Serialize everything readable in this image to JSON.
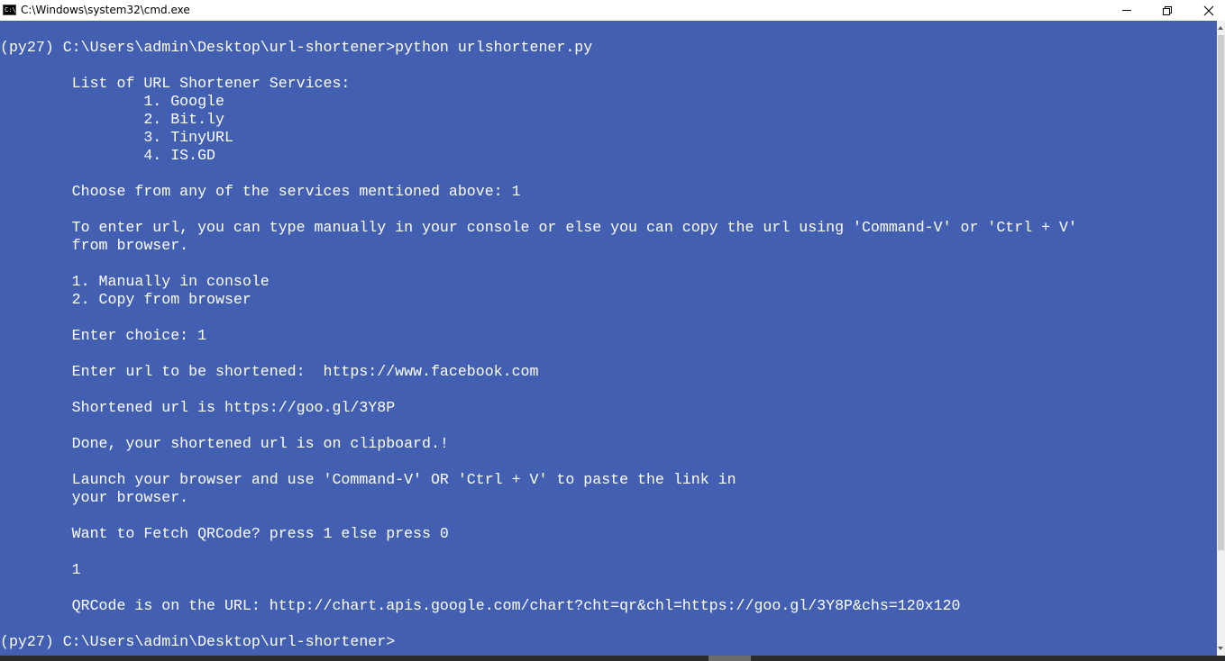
{
  "window": {
    "title": "C:\\Windows\\system32\\cmd.exe",
    "icon": "cmd-console-icon",
    "icon_glyph": "C:\\"
  },
  "controls": {
    "minimize_icon": "minimize-icon",
    "restore_icon": "restore-icon",
    "close_icon": "close-icon"
  },
  "colors": {
    "console_background": "#425fb1",
    "console_text": "#ffffff",
    "titlebar_background": "#ffffff"
  },
  "console": {
    "lines": [
      "(py27) C:\\Users\\admin\\Desktop\\url-shortener>python urlshortener.py",
      "",
      "        List of URL Shortener Services:",
      "                1. Google",
      "                2. Bit.ly",
      "                3. TinyURL",
      "                4. IS.GD",
      "",
      "        Choose from any of the services mentioned above: 1",
      "",
      "        To enter url, you can type manually in your console or else you can copy the url using 'Command-V' or 'Ctrl + V'",
      "        from browser.",
      "",
      "        1. Manually in console",
      "        2. Copy from browser",
      "",
      "        Enter choice: 1",
      "",
      "        Enter url to be shortened:  https://www.facebook.com",
      "",
      "        Shortened url is https://goo.gl/3Y8P",
      "",
      "        Done, your shortened url is on clipboard.!",
      "",
      "        Launch your browser and use 'Command-V' OR 'Ctrl + V' to paste the link in",
      "        your browser.",
      "",
      "        Want to Fetch QRCode? press 1 else press 0",
      "",
      "        1",
      "",
      "        QRCode is on the URL: http://chart.apis.google.com/chart?cht=qr&chl=https://goo.gl/3Y8P&chs=120x120",
      "",
      "(py27) C:\\Users\\admin\\Desktop\\url-shortener>"
    ]
  }
}
